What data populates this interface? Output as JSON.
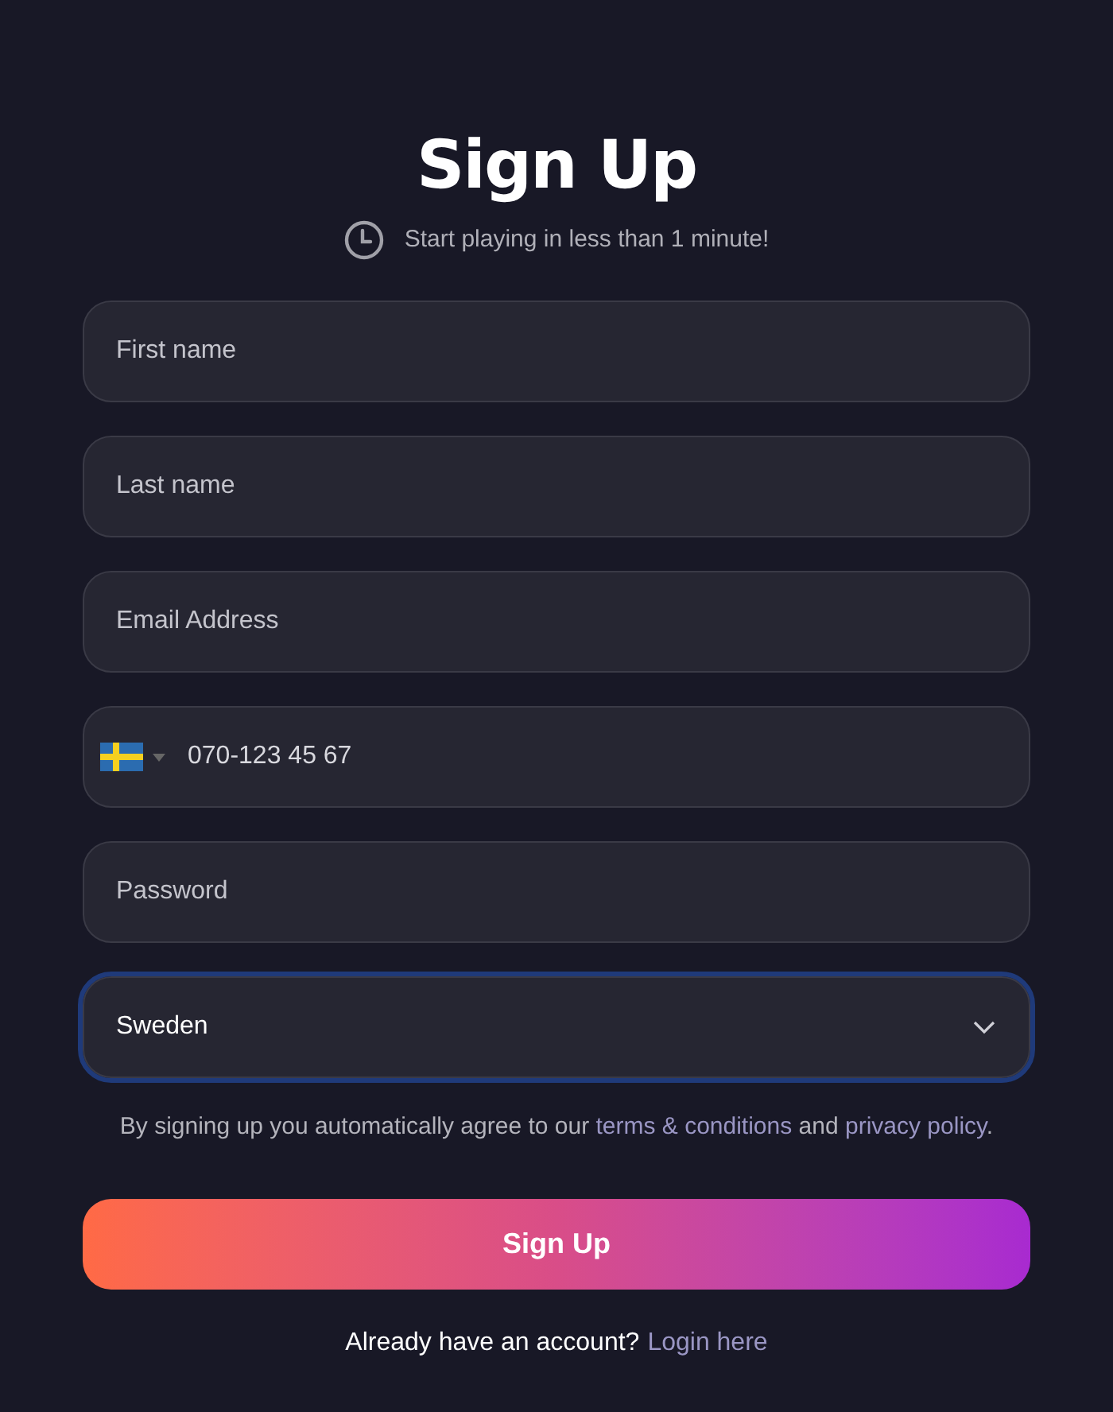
{
  "title": "Sign Up",
  "subtitle": "Start playing in less than 1 minute!",
  "fields": [
    {
      "kind": "text",
      "placeholder": "First name"
    },
    {
      "kind": "text",
      "placeholder": "Last name"
    },
    {
      "kind": "text",
      "placeholder": "Email Address"
    },
    {
      "kind": "phone",
      "placeholder": "070-123 45 67"
    },
    {
      "kind": "password",
      "placeholder": "Password"
    },
    {
      "kind": "select",
      "value": "Sweden",
      "focused": true
    }
  ],
  "agreement": [
    {
      "kind": "text",
      "text": "By signing up you automatically agree to our "
    },
    {
      "kind": "link",
      "text": "terms & conditions"
    },
    {
      "kind": "text",
      "text": " and "
    },
    {
      "kind": "link",
      "text": "privacy policy"
    },
    {
      "kind": "text",
      "text": "."
    }
  ],
  "submit_button": "Sign Up",
  "login_prompt": {
    "text": "Already have an account?",
    "link": "Login here"
  }
}
